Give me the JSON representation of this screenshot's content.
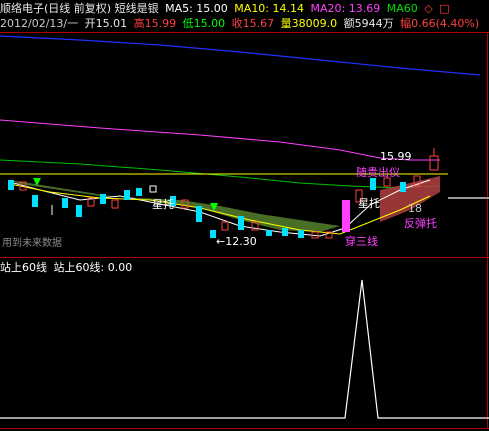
{
  "header": {
    "title": "顺络电子(日线 前复权) 短线是银",
    "ma5": "MA5: 15.00",
    "ma10": "MA10: 14.14",
    "ma20": "MA20: 13.69",
    "ma60": "MA60",
    "icons": [
      "diamond-icon",
      "square-icon"
    ]
  },
  "quote": {
    "date": "2012/02/13/一",
    "open": "开15.01",
    "high": "高15.99",
    "low": "低15.00",
    "close": "收15.67",
    "volume": "量38009.0",
    "amount": "额5944万",
    "change": "幅0.66(4.40%)"
  },
  "annotations": {
    "high_price": "15.99",
    "low_price": "←12.30",
    "lbl_xingtuo_1": "星托",
    "lbl_xingtuo_2": "星托",
    "lbl_chuansanxian": "穿三线",
    "lbl_fantantuo": "反弹托",
    "lbl_sui_mao": "随贵出仪",
    "lbl_right": "18",
    "watermark": "用到未来数据"
  },
  "indicator": {
    "name": "站上60线",
    "value_label": "站上60线: 0.00"
  },
  "colors": {
    "ma5": "#ffffff",
    "ma10": "#ffff00",
    "ma20": "#ff40ff",
    "ma60": "#00e000",
    "up": "#ff4040",
    "down": "#00e0ff",
    "frame": "#b00000",
    "blue_line": "#2030ff"
  }
}
